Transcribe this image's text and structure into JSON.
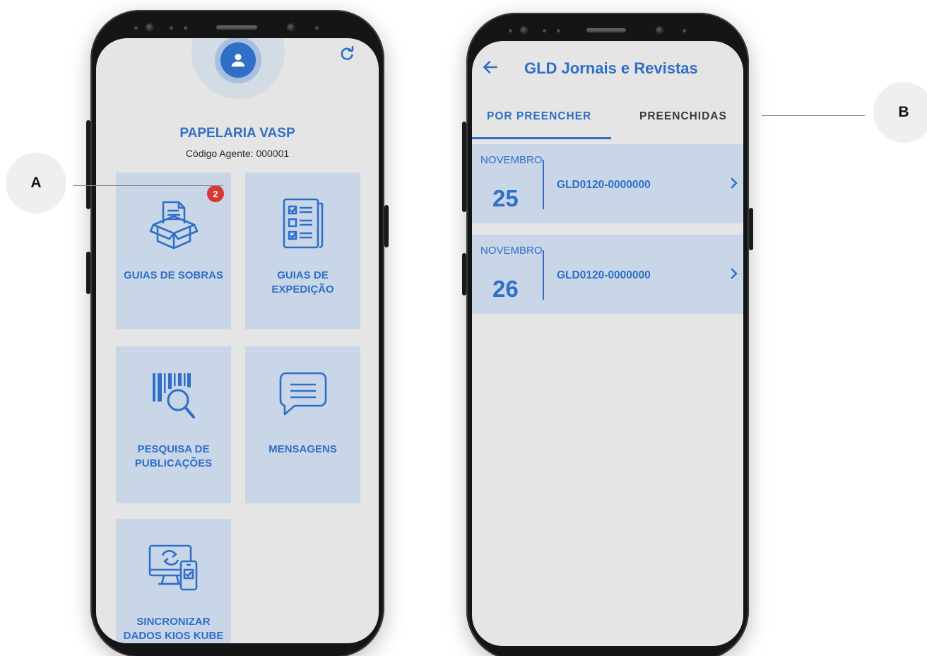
{
  "callouts": {
    "a_label": "A",
    "b_label": "B"
  },
  "home": {
    "avatar_icon": "user-icon",
    "refresh_icon": "refresh-icon",
    "store_name": "PAPELARIA VASP",
    "agent_code": "Código Agente: 000001",
    "badge_count": "2",
    "tiles": [
      {
        "label": "GUIAS DE SOBRAS",
        "icon": "box-document-icon"
      },
      {
        "label": "GUIAS DE\nEXPEDIÇÃO",
        "icon": "newspaper-checklist-icon"
      },
      {
        "label": "PESQUISA DE\nPUBLICAÇÕES",
        "icon": "barcode-search-icon"
      },
      {
        "label": "MENSAGENS",
        "icon": "message-icon"
      },
      {
        "label": "SINCRONIZAR\nDADOS KIOS KUBE",
        "icon": "sync-devices-icon"
      }
    ]
  },
  "list_screen": {
    "title": "GLD Jornais e Revistas",
    "back_icon": "back-arrow-icon",
    "tabs": [
      {
        "label": "POR PREENCHER",
        "active": true
      },
      {
        "label": "PREENCHIDAS",
        "active": false
      }
    ],
    "rows": [
      {
        "month": "NOVEMBRO",
        "day": "25",
        "guide": "GLD0120-0000000"
      },
      {
        "month": "NOVEMBRO",
        "day": "26",
        "guide": "GLD0120-0000000"
      }
    ]
  },
  "colors": {
    "accent": "#2f6fc8",
    "tile_bg": "#c8d6e8",
    "screen_bg": "#e5e5e5",
    "badge": "#d93636"
  }
}
